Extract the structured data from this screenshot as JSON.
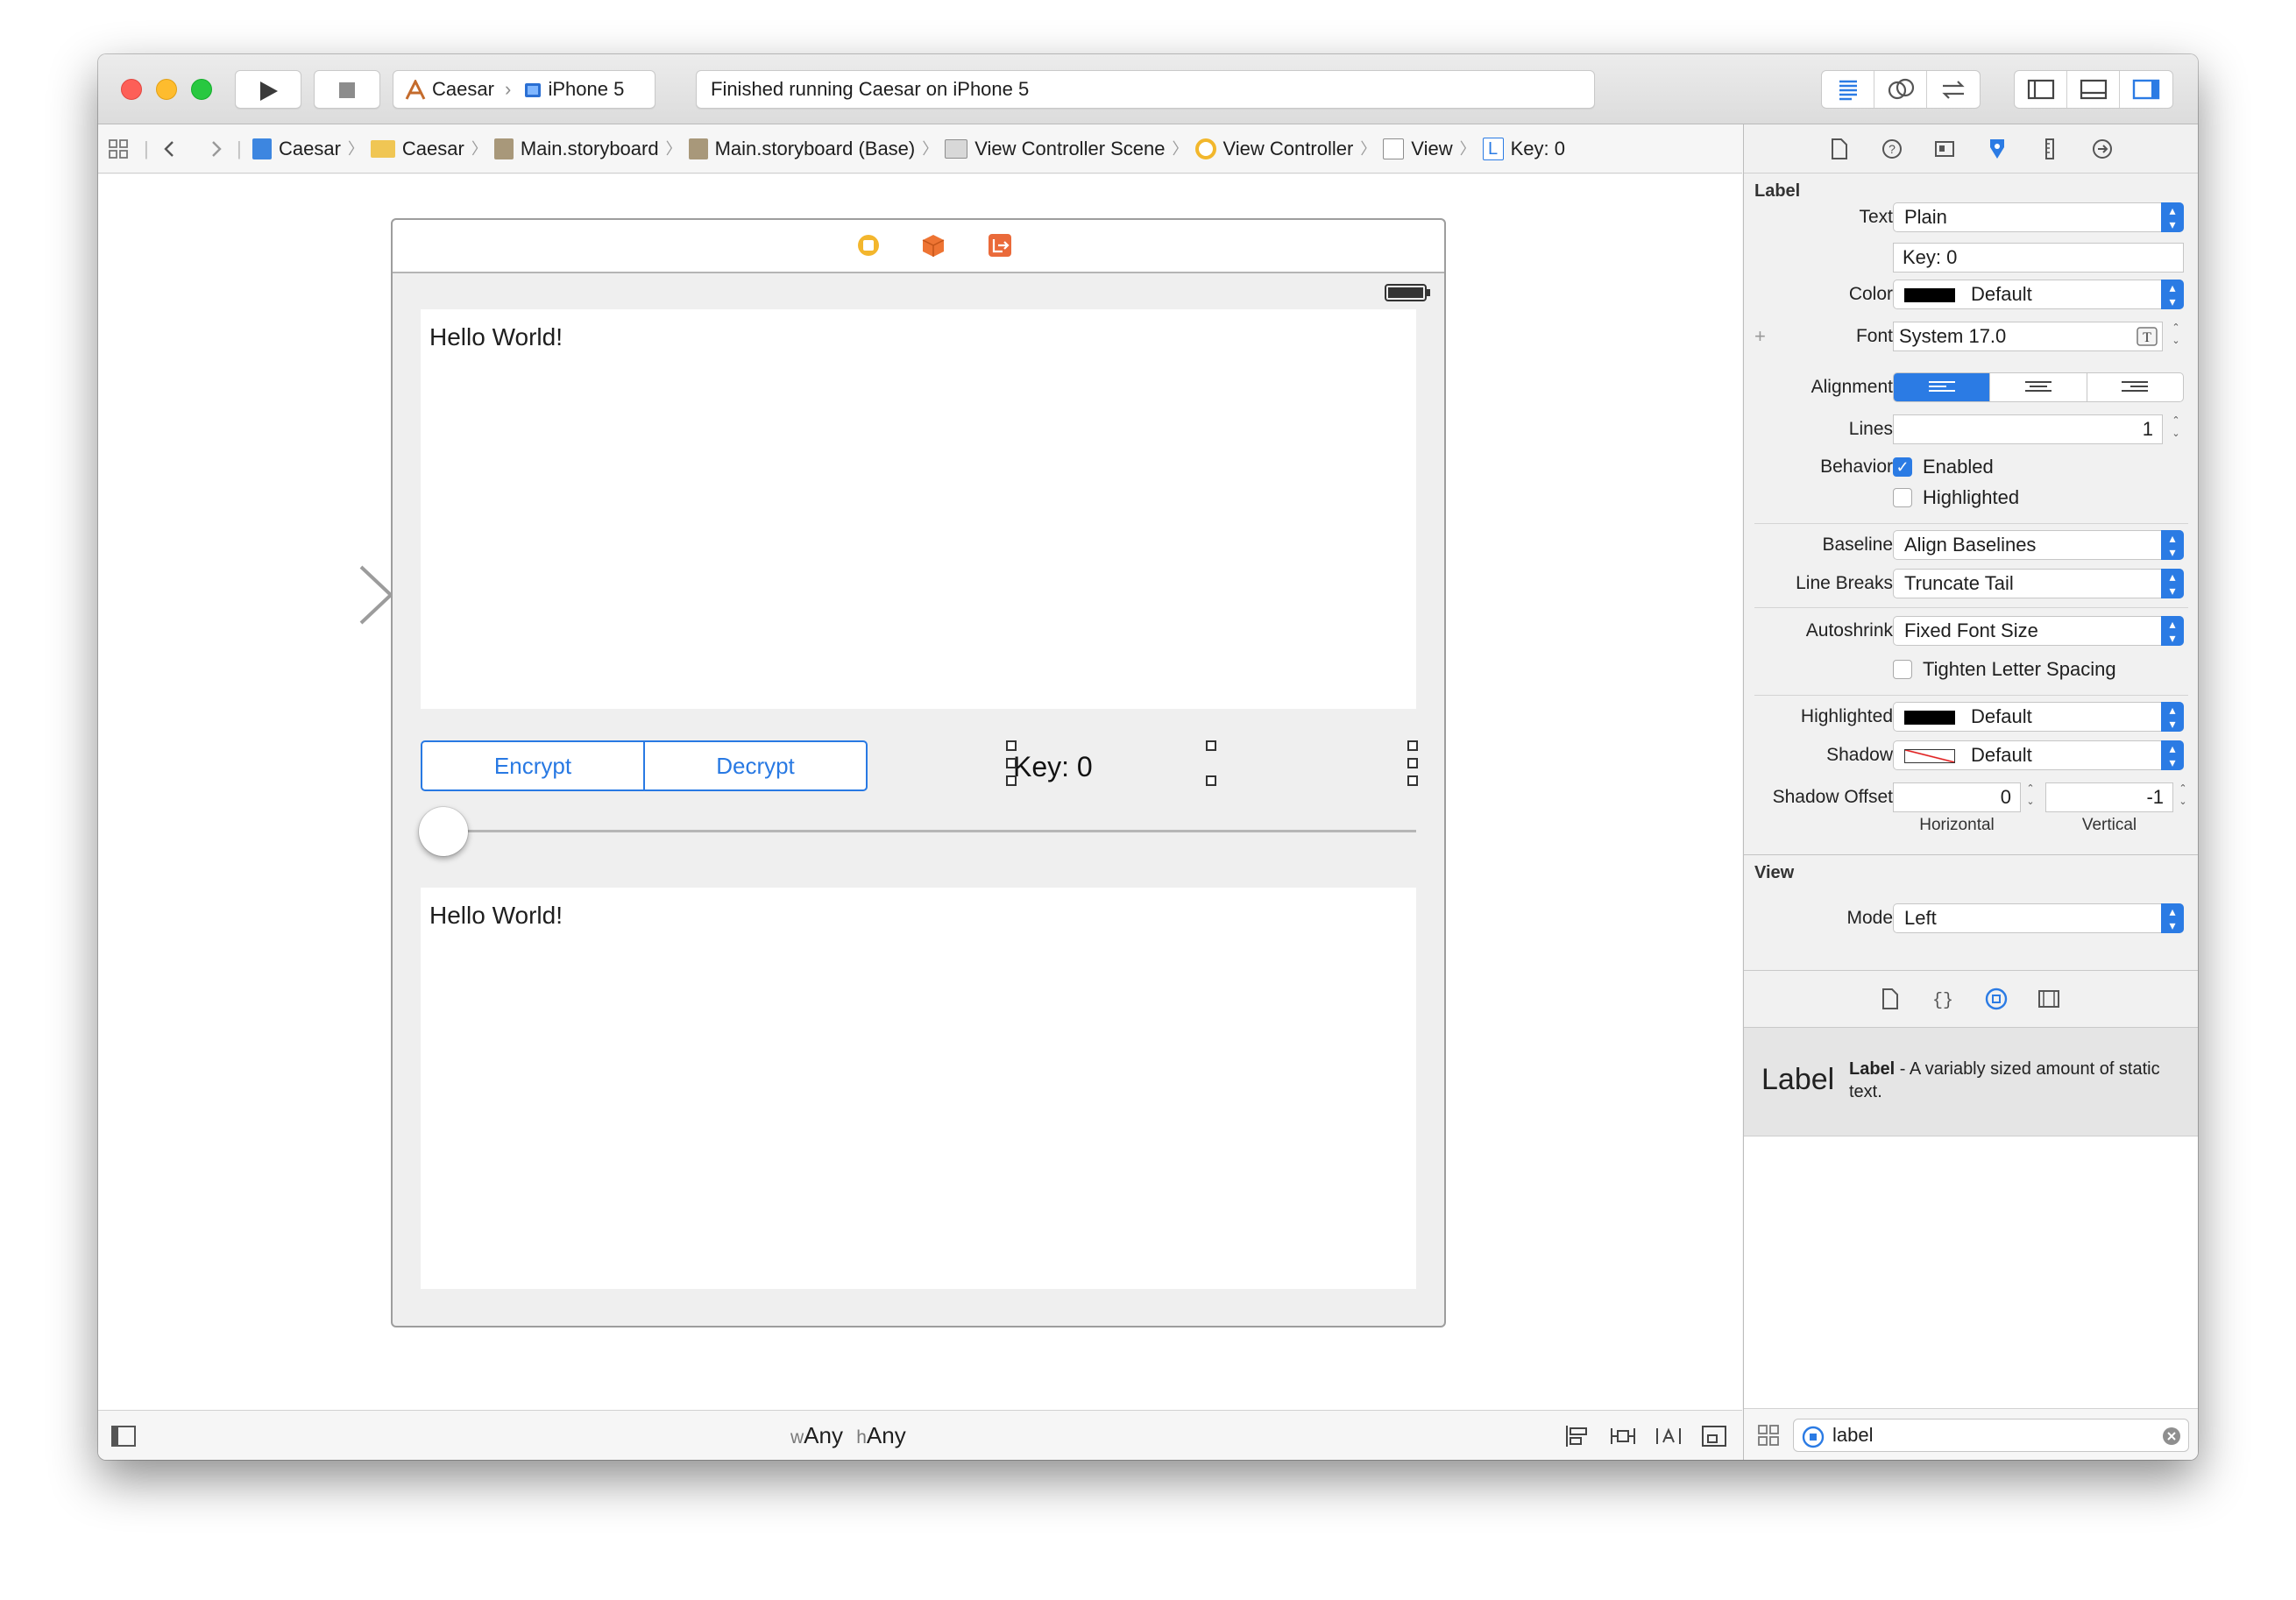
{
  "titlebar": {
    "scheme": "Caesar",
    "destination": "iPhone 5",
    "status": "Finished running Caesar on iPhone 5"
  },
  "jumpbar": {
    "items": [
      "Caesar",
      "Caesar",
      "Main.storyboard",
      "Main.storyboard (Base)",
      "View Controller Scene",
      "View Controller",
      "View",
      "Key: 0"
    ]
  },
  "scene": {
    "text_top": "Hello World!",
    "text_bottom": "Hello World!",
    "segment_left": "Encrypt",
    "segment_right": "Decrypt",
    "key_label": "Key: 0",
    "slider_value": 0
  },
  "footer": {
    "w_prefix": "w",
    "w_value": "Any",
    "h_prefix": "h",
    "h_value": "Any"
  },
  "inspector": {
    "label_section": "Label",
    "text_label": "Text",
    "text_type": "Plain",
    "text_value": "Key: 0",
    "color_label": "Color",
    "color_value": "Default",
    "font_plus": "+",
    "font_label": "Font",
    "font_value": "System 17.0",
    "alignment_label": "Alignment",
    "lines_label": "Lines",
    "lines_value": "1",
    "behavior_label": "Behavior",
    "enabled_label": "Enabled",
    "highlighted_cb_label": "Highlighted",
    "baseline_label": "Baseline",
    "baseline_value": "Align Baselines",
    "linebreaks_label": "Line Breaks",
    "linebreaks_value": "Truncate Tail",
    "autoshrink_label": "Autoshrink",
    "autoshrink_value": "Fixed Font Size",
    "tighten_label": "Tighten Letter Spacing",
    "highlighted_label": "Highlighted",
    "highlighted_value": "Default",
    "shadow_label": "Shadow",
    "shadow_value": "Default",
    "shadow_offset_label": "Shadow Offset",
    "shadow_h_value": "0",
    "shadow_v_value": "-1",
    "horizontal_caption": "Horizontal",
    "vertical_caption": "Vertical",
    "view_section": "View",
    "mode_label": "Mode",
    "mode_value": "Left"
  },
  "library": {
    "item_icon_text": "Label",
    "item_title": "Label",
    "item_desc": " - A variably sized amount of static text.",
    "search_value": "label"
  },
  "colors": {
    "accent": "#2b7be4",
    "close": "#fd5f57",
    "minimize": "#febc2e",
    "zoom": "#28c840"
  }
}
